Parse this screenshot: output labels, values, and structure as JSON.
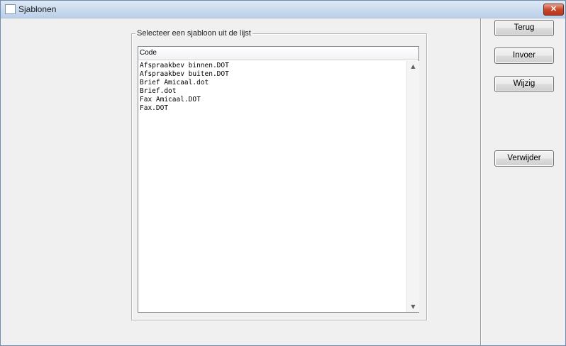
{
  "window": {
    "title": "Sjablonen",
    "close_glyph": "✕"
  },
  "group": {
    "legend": "Selecteer een sjabloon uit de lijst"
  },
  "list": {
    "column_header": "Code",
    "items": [
      "Afspraakbev binnen.DOT",
      "Afspraakbev buiten.DOT",
      "Brief Amicaal.dot",
      "Brief.dot",
      "Fax Amicaal.DOT",
      "Fax.DOT"
    ]
  },
  "buttons": {
    "terug": "Terug",
    "invoer": "Invoer",
    "wijzig": "Wijzig",
    "verwijder": "Verwijder"
  },
  "icons": {
    "scroll_up": "▲",
    "scroll_down": "▼"
  }
}
